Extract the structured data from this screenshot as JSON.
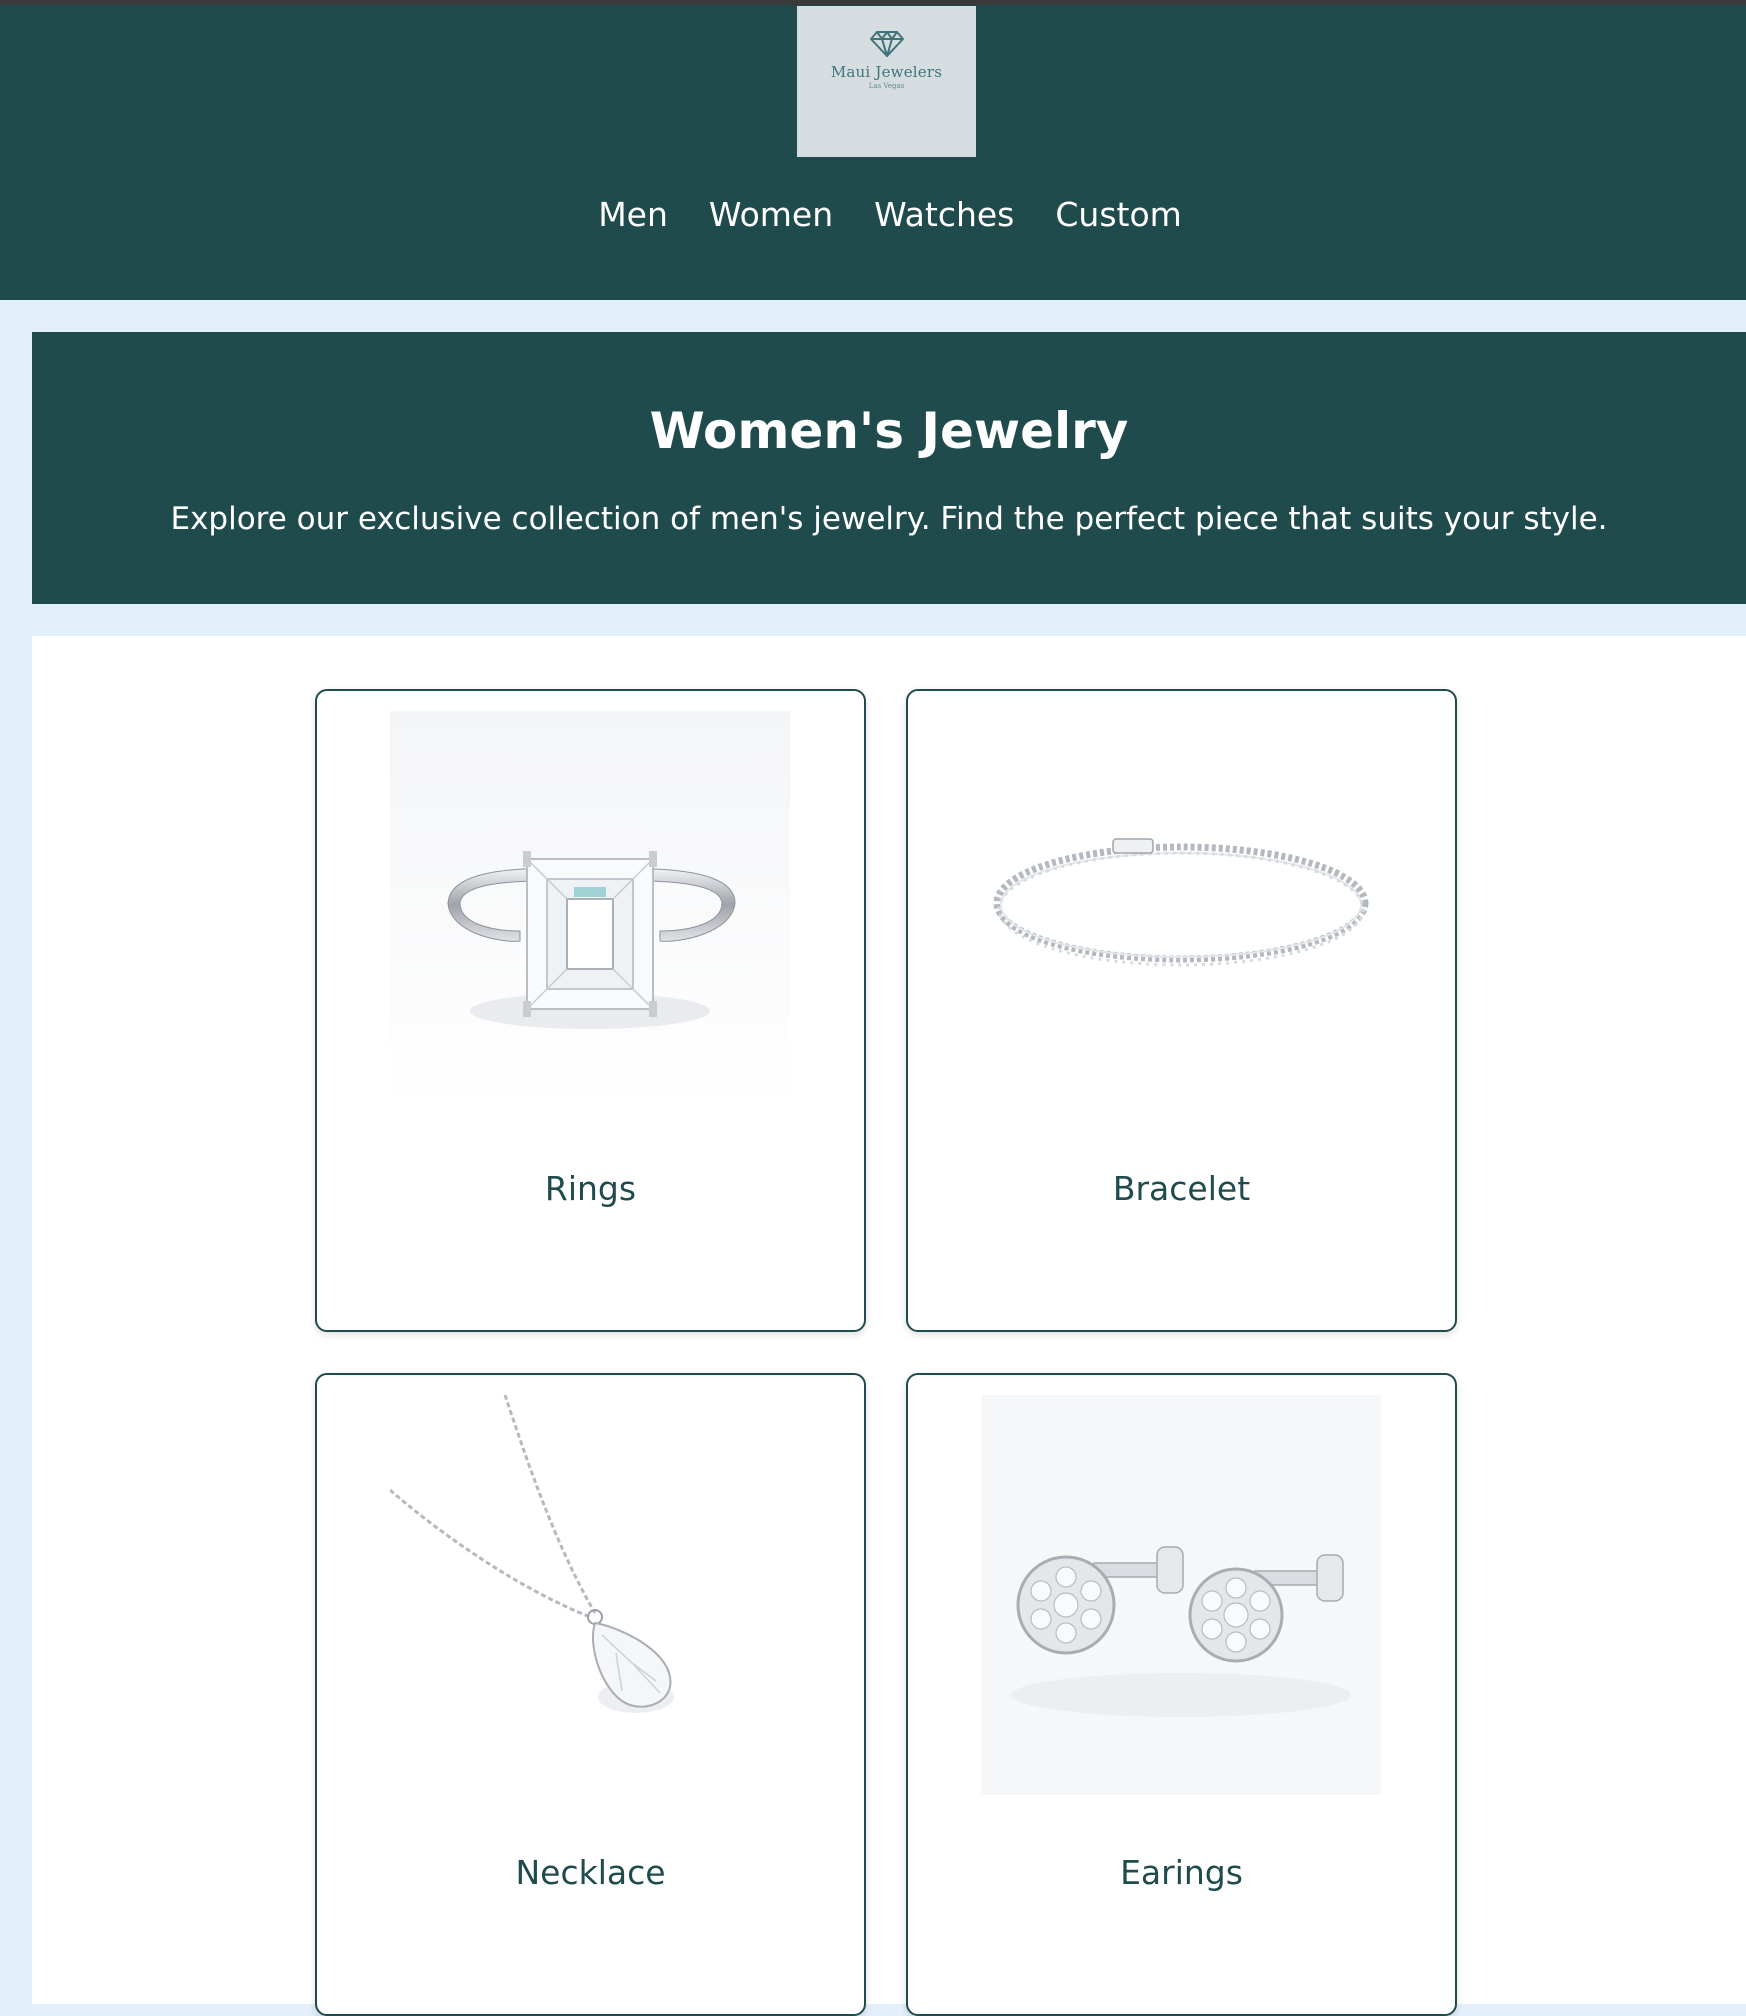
{
  "brand": {
    "name": "Maui Jewelers",
    "location": "Las Vegas",
    "logo_icon": "diamond-icon"
  },
  "nav": {
    "items": [
      {
        "label": "Men"
      },
      {
        "label": "Women"
      },
      {
        "label": "Watches"
      },
      {
        "label": "Custom"
      }
    ]
  },
  "hero": {
    "title": "Women's Jewelry",
    "subtitle": "Explore our exclusive collection of men's jewelry. Find the perfect piece that suits your style."
  },
  "categories": [
    {
      "label": "Rings",
      "image": "emerald-cut-diamond-ring"
    },
    {
      "label": "Bracelet",
      "image": "diamond-tennis-bracelet"
    },
    {
      "label": "Necklace",
      "image": "pear-diamond-pendant-necklace"
    },
    {
      "label": "Earings",
      "image": "diamond-cluster-stud-earrings"
    }
  ],
  "colors": {
    "primary": "#1f4b4d",
    "page_bg": "#e3effb",
    "logo_bg": "#d5dde0",
    "text_light": "#ffffff"
  }
}
